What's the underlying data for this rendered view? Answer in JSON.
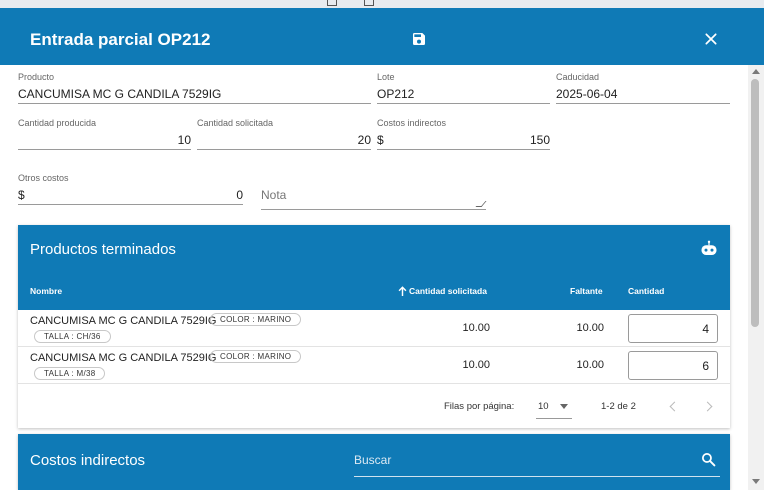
{
  "dialog": {
    "title": "Entrada parcial OP212"
  },
  "form": {
    "producto": {
      "label": "Producto",
      "value": "CANCUMISA MC G CANDILA 7529IG"
    },
    "lote": {
      "label": "Lote",
      "value": "OP212"
    },
    "caducidad": {
      "label": "Caducidad",
      "value": "2025-06-04"
    },
    "cantidad_producida": {
      "label": "Cantidad producida",
      "value": "10"
    },
    "cantidad_solicitada": {
      "label": "Cantidad solicitada",
      "value": "20"
    },
    "costos_indirectos": {
      "label": "Costos indirectos",
      "prefix": "$",
      "value": "150"
    },
    "otros_costos": {
      "label": "Otros costos",
      "prefix": "$",
      "value": "0"
    },
    "nota": {
      "placeholder": "Nota"
    }
  },
  "productos": {
    "title": "Productos terminados",
    "columns": {
      "nombre": "Nombre",
      "cantidad_solicitada": "Cantidad solicitada",
      "faltante": "Faltante",
      "cantidad": "Cantidad"
    },
    "rows": [
      {
        "name": "CANCUMISA MC G CANDILA 7529IG",
        "chip_color": "COLOR : MARINO",
        "chip_talla": "TALLA : CH/36",
        "solicitada": "10.00",
        "faltante": "10.00",
        "cantidad": "4"
      },
      {
        "name": "CANCUMISA MC G CANDILA 7529IG",
        "chip_color": "COLOR : MARINO",
        "chip_talla": "TALLA : M/38",
        "solicitada": "10.00",
        "faltante": "10.00",
        "cantidad": "6"
      }
    ],
    "pagination": {
      "rows_per_page_label": "Filas por página:",
      "rows_per_page": "10",
      "range": "1-2 de 2"
    }
  },
  "costos": {
    "title": "Costos indirectos",
    "search_placeholder": "Buscar"
  },
  "colors": {
    "primary": "#0f7ab6",
    "background": "#ffffff"
  },
  "icons": {
    "save": "save-icon",
    "close": "close-icon",
    "robot": "robot-icon",
    "sort": "arrow-up-icon",
    "search": "search-icon"
  }
}
